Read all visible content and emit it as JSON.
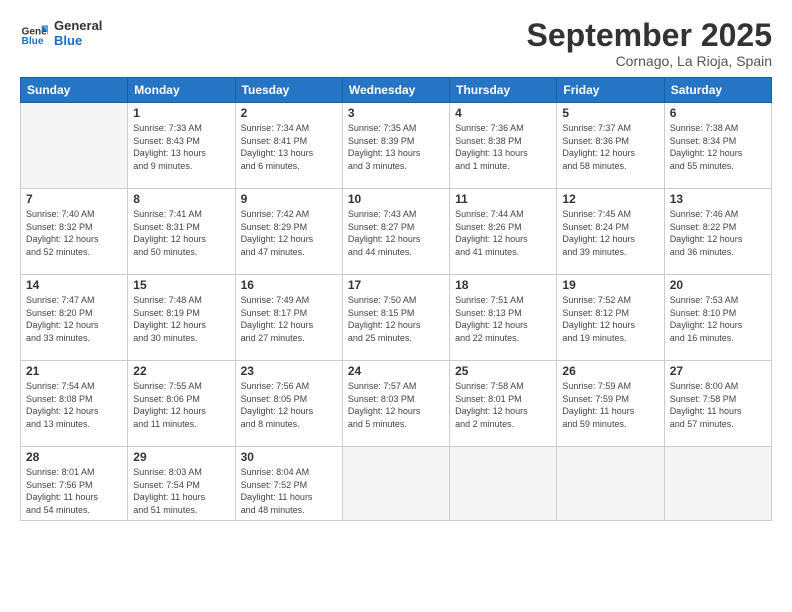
{
  "logo": {
    "line1": "General",
    "line2": "Blue"
  },
  "title": "September 2025",
  "location": "Cornago, La Rioja, Spain",
  "weekdays": [
    "Sunday",
    "Monday",
    "Tuesday",
    "Wednesday",
    "Thursday",
    "Friday",
    "Saturday"
  ],
  "weeks": [
    [
      {
        "day": "",
        "info": ""
      },
      {
        "day": "1",
        "info": "Sunrise: 7:33 AM\nSunset: 8:43 PM\nDaylight: 13 hours\nand 9 minutes."
      },
      {
        "day": "2",
        "info": "Sunrise: 7:34 AM\nSunset: 8:41 PM\nDaylight: 13 hours\nand 6 minutes."
      },
      {
        "day": "3",
        "info": "Sunrise: 7:35 AM\nSunset: 8:39 PM\nDaylight: 13 hours\nand 3 minutes."
      },
      {
        "day": "4",
        "info": "Sunrise: 7:36 AM\nSunset: 8:38 PM\nDaylight: 13 hours\nand 1 minute."
      },
      {
        "day": "5",
        "info": "Sunrise: 7:37 AM\nSunset: 8:36 PM\nDaylight: 12 hours\nand 58 minutes."
      },
      {
        "day": "6",
        "info": "Sunrise: 7:38 AM\nSunset: 8:34 PM\nDaylight: 12 hours\nand 55 minutes."
      }
    ],
    [
      {
        "day": "7",
        "info": "Sunrise: 7:40 AM\nSunset: 8:32 PM\nDaylight: 12 hours\nand 52 minutes."
      },
      {
        "day": "8",
        "info": "Sunrise: 7:41 AM\nSunset: 8:31 PM\nDaylight: 12 hours\nand 50 minutes."
      },
      {
        "day": "9",
        "info": "Sunrise: 7:42 AM\nSunset: 8:29 PM\nDaylight: 12 hours\nand 47 minutes."
      },
      {
        "day": "10",
        "info": "Sunrise: 7:43 AM\nSunset: 8:27 PM\nDaylight: 12 hours\nand 44 minutes."
      },
      {
        "day": "11",
        "info": "Sunrise: 7:44 AM\nSunset: 8:26 PM\nDaylight: 12 hours\nand 41 minutes."
      },
      {
        "day": "12",
        "info": "Sunrise: 7:45 AM\nSunset: 8:24 PM\nDaylight: 12 hours\nand 39 minutes."
      },
      {
        "day": "13",
        "info": "Sunrise: 7:46 AM\nSunset: 8:22 PM\nDaylight: 12 hours\nand 36 minutes."
      }
    ],
    [
      {
        "day": "14",
        "info": "Sunrise: 7:47 AM\nSunset: 8:20 PM\nDaylight: 12 hours\nand 33 minutes."
      },
      {
        "day": "15",
        "info": "Sunrise: 7:48 AM\nSunset: 8:19 PM\nDaylight: 12 hours\nand 30 minutes."
      },
      {
        "day": "16",
        "info": "Sunrise: 7:49 AM\nSunset: 8:17 PM\nDaylight: 12 hours\nand 27 minutes."
      },
      {
        "day": "17",
        "info": "Sunrise: 7:50 AM\nSunset: 8:15 PM\nDaylight: 12 hours\nand 25 minutes."
      },
      {
        "day": "18",
        "info": "Sunrise: 7:51 AM\nSunset: 8:13 PM\nDaylight: 12 hours\nand 22 minutes."
      },
      {
        "day": "19",
        "info": "Sunrise: 7:52 AM\nSunset: 8:12 PM\nDaylight: 12 hours\nand 19 minutes."
      },
      {
        "day": "20",
        "info": "Sunrise: 7:53 AM\nSunset: 8:10 PM\nDaylight: 12 hours\nand 16 minutes."
      }
    ],
    [
      {
        "day": "21",
        "info": "Sunrise: 7:54 AM\nSunset: 8:08 PM\nDaylight: 12 hours\nand 13 minutes."
      },
      {
        "day": "22",
        "info": "Sunrise: 7:55 AM\nSunset: 8:06 PM\nDaylight: 12 hours\nand 11 minutes."
      },
      {
        "day": "23",
        "info": "Sunrise: 7:56 AM\nSunset: 8:05 PM\nDaylight: 12 hours\nand 8 minutes."
      },
      {
        "day": "24",
        "info": "Sunrise: 7:57 AM\nSunset: 8:03 PM\nDaylight: 12 hours\nand 5 minutes."
      },
      {
        "day": "25",
        "info": "Sunrise: 7:58 AM\nSunset: 8:01 PM\nDaylight: 12 hours\nand 2 minutes."
      },
      {
        "day": "26",
        "info": "Sunrise: 7:59 AM\nSunset: 7:59 PM\nDaylight: 11 hours\nand 59 minutes."
      },
      {
        "day": "27",
        "info": "Sunrise: 8:00 AM\nSunset: 7:58 PM\nDaylight: 11 hours\nand 57 minutes."
      }
    ],
    [
      {
        "day": "28",
        "info": "Sunrise: 8:01 AM\nSunset: 7:56 PM\nDaylight: 11 hours\nand 54 minutes."
      },
      {
        "day": "29",
        "info": "Sunrise: 8:03 AM\nSunset: 7:54 PM\nDaylight: 11 hours\nand 51 minutes."
      },
      {
        "day": "30",
        "info": "Sunrise: 8:04 AM\nSunset: 7:52 PM\nDaylight: 11 hours\nand 48 minutes."
      },
      {
        "day": "",
        "info": ""
      },
      {
        "day": "",
        "info": ""
      },
      {
        "day": "",
        "info": ""
      },
      {
        "day": "",
        "info": ""
      }
    ]
  ]
}
